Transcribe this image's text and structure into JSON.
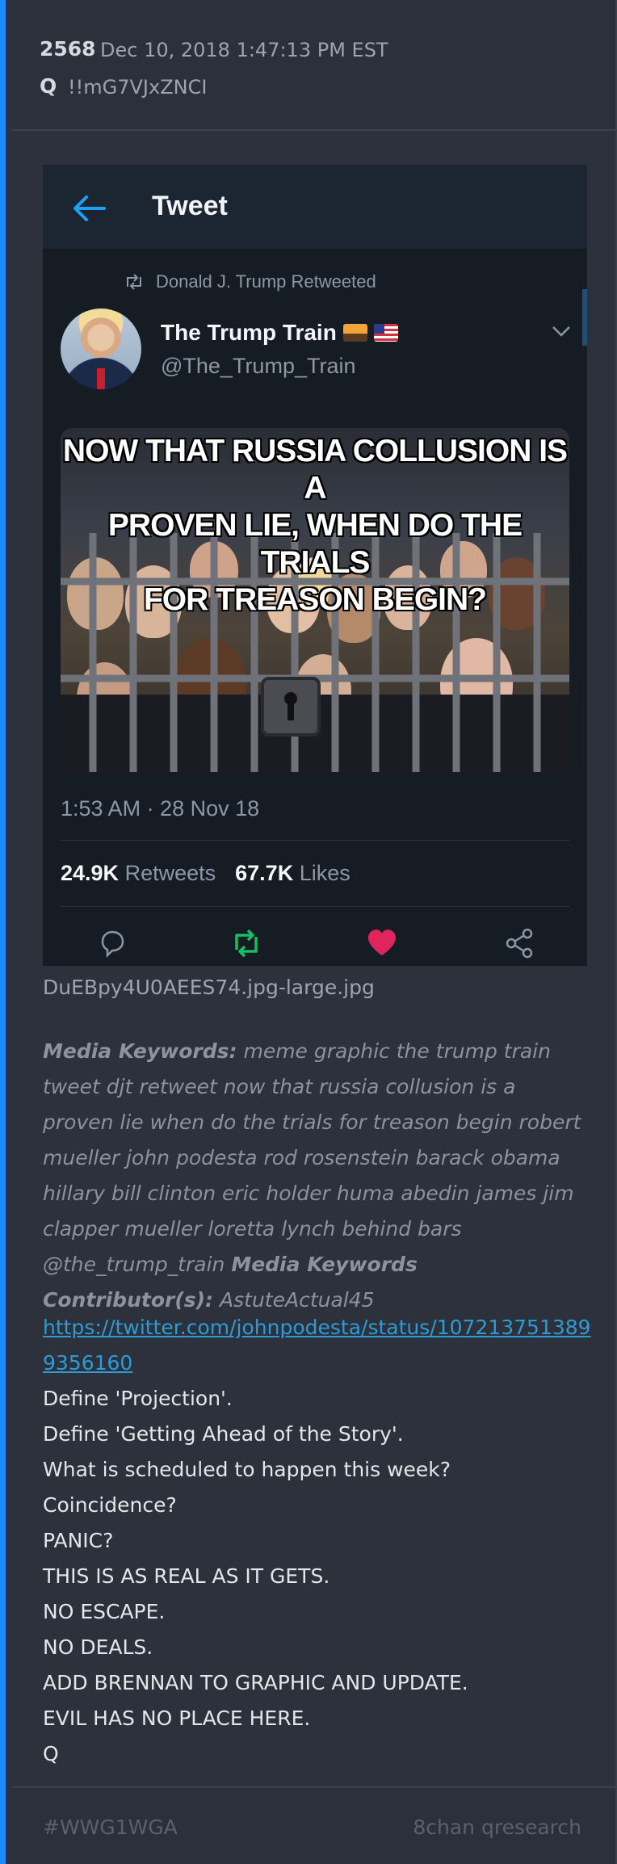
{
  "post": {
    "number": "2568",
    "date": "Dec 10, 2018 1:47:13 PM EST",
    "author": "Q",
    "tripcode": "!!mG7VJxZNCI"
  },
  "tweet": {
    "title": "Tweet",
    "retweeted_by": "Donald J. Trump Retweeted",
    "name": "The Trump Train",
    "handle": "@The_Trump_Train",
    "image_caption": "NOW THAT RUSSIA COLLUSION IS A\nPROVEN LIE, WHEN DO THE TRIALS\nFOR TREASON BEGIN?",
    "time": "1:53 AM · 28 Nov 18",
    "retweets_count": "24.9K",
    "retweets_label": "Retweets",
    "likes_count": "67.7K",
    "likes_label": "Likes",
    "icons": [
      "back-arrow-icon",
      "retweet-icon",
      "chevron-down-icon",
      "reply-icon",
      "retweet-icon",
      "heart-icon",
      "share-icon"
    ],
    "colors": {
      "retweet": "#17bf63",
      "like": "#e0245e",
      "link_blue": "#1da1f2"
    }
  },
  "attachment": {
    "filename": "DuEBpy4U0AEES74.jpg-large.jpg"
  },
  "keywords": {
    "label": "Media Keywords:",
    "text": "meme graphic the trump train tweet djt retweet now that russia collusion is a proven lie when do the trials for treason begin robert mueller john podesta rod rosenstein barack obama hillary bill clinton eric holder huma abedin james jim clapper mueller loretta lynch behind bars @the_trump_train",
    "contributor_label": "Media Keywords Contributor(s):",
    "contributor": "AstuteActual45"
  },
  "body": {
    "link": "https://twitter.com/johnpodesta/status/1072137513899356160",
    "lines": [
      "Define 'Projection'.",
      "Define 'Getting Ahead of the Story'.",
      "What is scheduled to happen this week?",
      "Coincidence?",
      "PANIC?",
      "THIS IS AS REAL AS IT GETS.",
      "NO ESCAPE.",
      "NO DEALS.",
      "ADD BRENNAN TO GRAPHIC AND UPDATE.",
      "EVIL HAS NO PLACE HERE.",
      "Q"
    ]
  },
  "footer": {
    "hashtag": "#WWG1WGA",
    "source": "8chan qresearch"
  },
  "colors": {
    "accent": "#1a8cff",
    "background": "#2c313b",
    "link": "#2d9bd6"
  }
}
